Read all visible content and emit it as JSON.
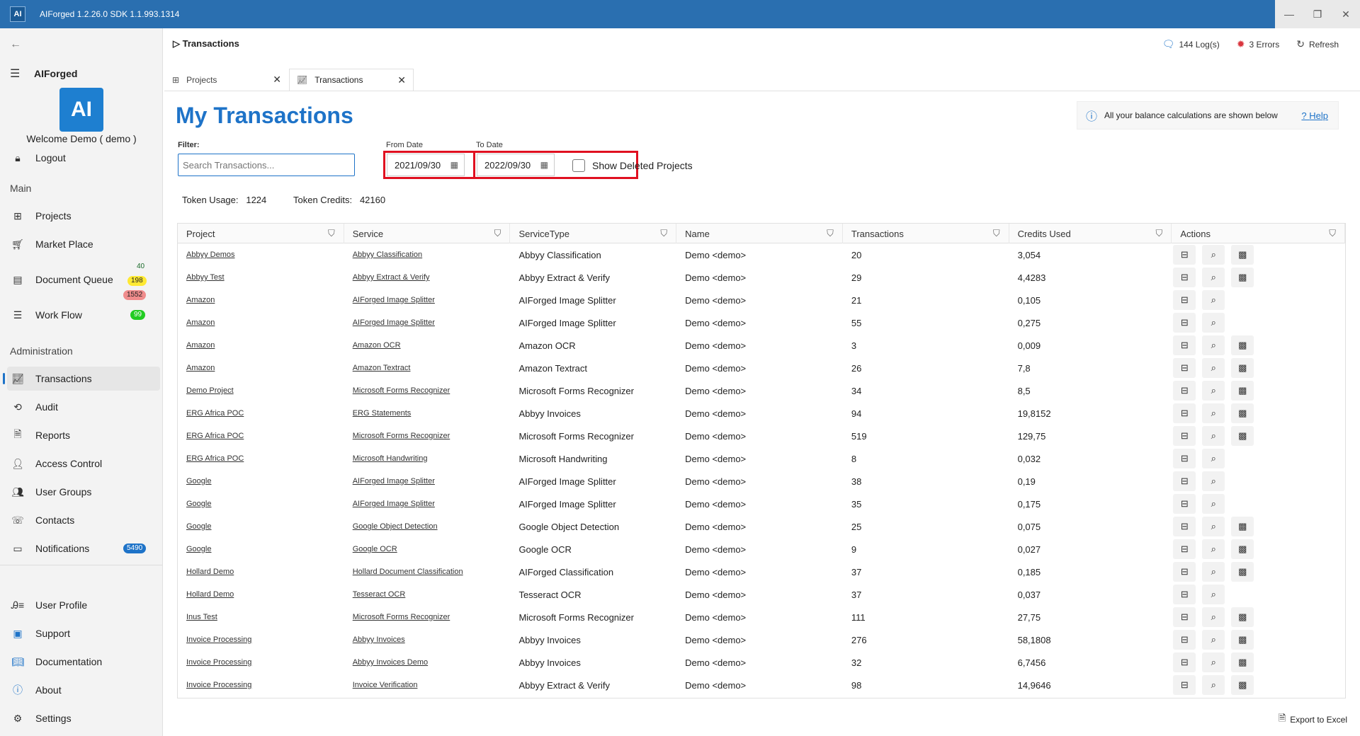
{
  "titlebar": {
    "app_icon": "AI",
    "title": "AIForged   1.2.26.0   SDK  1.1.993.1314",
    "minimize": "—",
    "maximize": "❐",
    "close": "✕"
  },
  "sidebar": {
    "back_icon": "←",
    "app_name": "AIForged",
    "logo_text": "AI",
    "welcome": "Welcome  Demo  ( demo )",
    "logout": "Logout",
    "section_main": "Main",
    "projects": "Projects",
    "market_place": "Market Place",
    "document_queue": "Document Queue",
    "dq_badge_1": "40",
    "dq_badge_2": "198",
    "dq_badge_3": "1552",
    "work_flow": "Work Flow",
    "wf_badge": "99",
    "section_admin": "Administration",
    "transactions": "Transactions",
    "audit": "Audit",
    "reports": "Reports",
    "access_control": "Access Control",
    "user_groups": "User Groups",
    "contacts": "Contacts",
    "notifications": "Notifications",
    "notif_badge": "5490",
    "user_profile": "User Profile",
    "support": "Support",
    "documentation": "Documentation",
    "about": "About",
    "settings": "Settings"
  },
  "breadcrumb": "Transactions",
  "top_actions": {
    "logs": "144 Log(s)",
    "errors": "3 Errors",
    "refresh": "Refresh"
  },
  "tabs": [
    {
      "label": "Projects"
    },
    {
      "label": "Transactions"
    }
  ],
  "main": {
    "title": "My Transactions",
    "info_text": "All your balance calculations are shown below",
    "help": "Help",
    "filter_label": "Filter:",
    "search_placeholder": "Search Transactions...",
    "from_label": "From Date",
    "to_label": "To Date",
    "from_date": "2021/09/30",
    "to_date": "2022/09/30",
    "show_deleted": "Show Deleted Projects",
    "token_usage_label": "Token Usage:",
    "token_usage": "1224",
    "token_credits_label": "Token Credits:",
    "token_credits": "42160",
    "export": "Export to Excel"
  },
  "table": {
    "headers": [
      "Project",
      "Service",
      "ServiceType",
      "Name",
      "Transactions",
      "Credits Used",
      "Actions"
    ],
    "rows": [
      [
        "Abbyy Demos",
        "Abbyy Classification",
        "Abbyy Classification",
        "Demo <demo>",
        "20",
        "3,054",
        "3"
      ],
      [
        "Abbyy Test",
        "Abbyy Extract & Verify",
        "Abbyy Extract & Verify",
        "Demo <demo>",
        "29",
        "4,4283",
        "3"
      ],
      [
        "Amazon",
        "AIForged Image Splitter",
        "AIForged Image Splitter",
        "Demo <demo>",
        "21",
        "0,105",
        "2"
      ],
      [
        "Amazon",
        "AIForged Image Splitter",
        "AIForged Image Splitter",
        "Demo <demo>",
        "55",
        "0,275",
        "2"
      ],
      [
        "Amazon",
        "Amazon OCR",
        "Amazon OCR",
        "Demo <demo>",
        "3",
        "0,009",
        "3"
      ],
      [
        "Amazon",
        "Amazon Textract",
        "Amazon Textract",
        "Demo <demo>",
        "26",
        "7,8",
        "3"
      ],
      [
        "Demo Project",
        "Microsoft Forms Recognizer",
        "Microsoft Forms Recognizer",
        "Demo <demo>",
        "34",
        "8,5",
        "3"
      ],
      [
        "ERG Africa POC",
        "ERG Statements",
        "Abbyy Invoices",
        "Demo <demo>",
        "94",
        "19,8152",
        "3"
      ],
      [
        "ERG Africa POC",
        "Microsoft Forms Recognizer",
        "Microsoft Forms Recognizer",
        "Demo <demo>",
        "519",
        "129,75",
        "3"
      ],
      [
        "ERG Africa POC",
        "Microsoft Handwriting",
        "Microsoft Handwriting",
        "Demo <demo>",
        "8",
        "0,032",
        "2"
      ],
      [
        "Google",
        "AIForged Image Splitter",
        "AIForged Image Splitter",
        "Demo <demo>",
        "38",
        "0,19",
        "2"
      ],
      [
        "Google",
        "AIForged Image Splitter",
        "AIForged Image Splitter",
        "Demo <demo>",
        "35",
        "0,175",
        "2"
      ],
      [
        "Google",
        "Google Object Detection",
        "Google Object Detection",
        "Demo <demo>",
        "25",
        "0,075",
        "3"
      ],
      [
        "Google",
        "Google OCR",
        "Google OCR",
        "Demo <demo>",
        "9",
        "0,027",
        "3"
      ],
      [
        "Hollard Demo",
        "Hollard Document Classification",
        "AIForged Classification",
        "Demo <demo>",
        "37",
        "0,185",
        "3"
      ],
      [
        "Hollard Demo",
        "Tesseract OCR",
        "Tesseract OCR",
        "Demo <demo>",
        "37",
        "0,037",
        "2"
      ],
      [
        "Inus Test",
        "Microsoft Forms Recognizer",
        "Microsoft Forms Recognizer",
        "Demo <demo>",
        "111",
        "27,75",
        "3"
      ],
      [
        "Invoice Processing",
        "Abbyy Invoices",
        "Abbyy Invoices",
        "Demo <demo>",
        "276",
        "58,1808",
        "3"
      ],
      [
        "Invoice Processing",
        "Abbyy Invoices Demo",
        "Abbyy Invoices",
        "Demo <demo>",
        "32",
        "6,7456",
        "3"
      ],
      [
        "Invoice Processing",
        "Invoice Verification",
        "Abbyy Extract & Verify",
        "Demo <demo>",
        "98",
        "14,9646",
        "3"
      ]
    ]
  },
  "colors": {
    "accent": "#1e73c8",
    "titlebar": "#2a6fb0",
    "highlight": "#e01020"
  }
}
